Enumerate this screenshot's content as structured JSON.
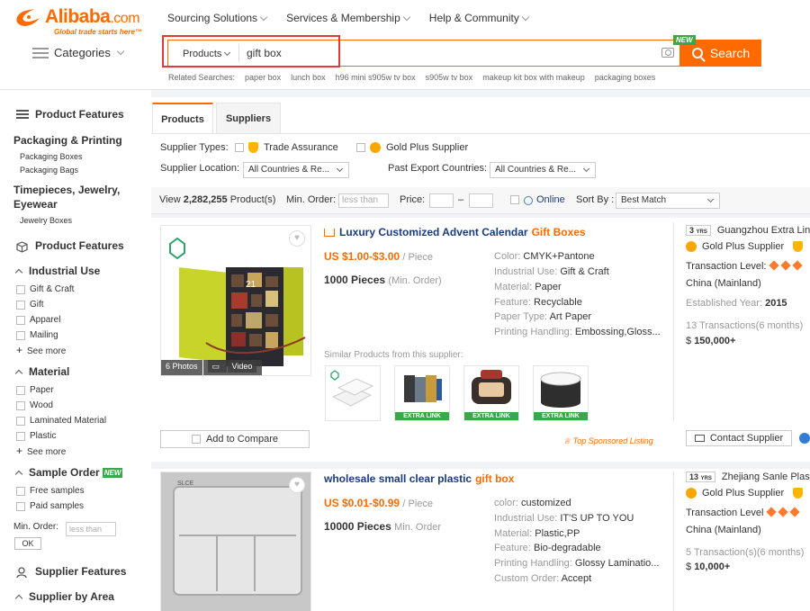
{
  "brand": {
    "name": "Alibaba",
    "tld": ".com",
    "tagline": "Global trade starts here™"
  },
  "topnav": [
    "Sourcing Solutions",
    "Services & Membership",
    "Help & Community"
  ],
  "categories_label": "Categories",
  "search": {
    "type": "Products",
    "query": "gift box",
    "button": "Search",
    "new_badge": "NEW"
  },
  "related": {
    "label": "Related Searches:",
    "items": [
      "paper box",
      "lunch box",
      "h96 mini s905w tv box",
      "s905w tv box",
      "makeup kit box with makeup",
      "packaging boxes"
    ]
  },
  "sidebar": {
    "product_features_title": "Product Features",
    "cat1": "Packaging & Printing",
    "cat1_subs": [
      "Packaging Boxes",
      "Packaging Bags"
    ],
    "cat2_line1": "Timepieces, Jewelry,",
    "cat2_line2": "Eyewear",
    "cat2_subs": [
      "Jewelry Boxes"
    ],
    "pf_title": "Product Features",
    "industrial_use": "Industrial Use",
    "industrial_items": [
      "Gift & Craft",
      "Gift",
      "Apparel",
      "Mailing"
    ],
    "see_more": "See more",
    "material": "Material",
    "material_items": [
      "Paper",
      "Wood",
      "Laminated Material",
      "Plastic"
    ],
    "sample_order": "Sample Order",
    "sample_new": "NEW",
    "sample_items": [
      "Free samples",
      "Paid samples"
    ],
    "min_order_label": "Min. Order:",
    "min_order_placeholder": "less than",
    "ok": "OK",
    "supplier_features": "Supplier Features",
    "supplier_by_area": "Supplier by Area"
  },
  "tabs": [
    "Products",
    "Suppliers"
  ],
  "filters": {
    "supplier_types_label": "Supplier Types:",
    "trade_assurance": "Trade Assurance",
    "gold_plus": "Gold Plus Supplier",
    "location_label": "Supplier Location:",
    "location_value": "All Countries & Re...",
    "export_label": "Past Export Countries:",
    "export_value": "All Countries & Re..."
  },
  "sortbar": {
    "view_prefix": "View",
    "count": "2,282,255",
    "count_suffix": "Product(s)",
    "min_order": "Min. Order:",
    "min_order_placeholder": "less than",
    "price": "Price:",
    "dash": "–",
    "online": "Online",
    "sort_by": "Sort By :",
    "sort_value": "Best Match"
  },
  "products": [
    {
      "title": "Luxury Customized Advent Calendar",
      "title_hl": "Gift Boxes",
      "price": "US $1.00-$3.00",
      "price_unit": "/ Piece",
      "moq": "1000 Pieces",
      "moq_unit": "(Min. Order)",
      "attrs": [
        {
          "k": "Color:",
          "v": "CMYK+Pantone"
        },
        {
          "k": "Industrial Use:",
          "v": "Gift & Craft"
        },
        {
          "k": "Material:",
          "v": "Paper"
        },
        {
          "k": "Feature:",
          "v": "Recyclable"
        },
        {
          "k": "Paper Type:",
          "v": "Art Paper"
        },
        {
          "k": "Printing Handling:",
          "v": "Embossing,Gloss..."
        }
      ],
      "photos": "6 Photos",
      "video": "Video",
      "similar_label": "Similar Products from this supplier:",
      "extra_link": "EXTRA LINK",
      "compare": "Add to Compare",
      "sponsored": "Top Sponsored Listing",
      "supplier": {
        "yrs": "3",
        "yrs_label": "YRS",
        "name": "Guangzhou Extra Lin",
        "gold": "Gold Plus Supplier",
        "transaction_level": "Transaction Level:",
        "country": "China (Mainland)",
        "established_label": "Established Year:",
        "established": "2015",
        "transactions": "13 Transactions(6 months)",
        "revenue": "150,000+",
        "contact": "Contact Supplier"
      }
    },
    {
      "title": "wholesale small clear plastic",
      "title_hl": "gift box",
      "price": "US $0.01-$0.99",
      "price_unit": "/ Piece",
      "moq": "10000 Pieces",
      "moq_unit": "Min. Order",
      "attrs": [
        {
          "k": "color:",
          "v": "customized"
        },
        {
          "k": "Industrial Use:",
          "v": "IT'S UP TO YOU"
        },
        {
          "k": "Material:",
          "v": "Plastic,PP"
        },
        {
          "k": "Feature:",
          "v": "Bio-degradable"
        },
        {
          "k": "Printing Handling:",
          "v": "Glossy Laminatio..."
        },
        {
          "k": "Custom Order:",
          "v": "Accept"
        }
      ],
      "supplier": {
        "yrs": "13",
        "yrs_label": "YRS",
        "name": "Zhejiang Sanle Plas",
        "gold": "Gold Plus Supplier",
        "transaction_level": "Transaction Level",
        "country": "China (Mainland)",
        "transactions": "5 Transaction(s)(6 months)",
        "revenue": "10,000+"
      }
    }
  ],
  "colors": {
    "accent": "#ff6a00",
    "title": "#1a3c7a",
    "green": "#3ba74b"
  }
}
